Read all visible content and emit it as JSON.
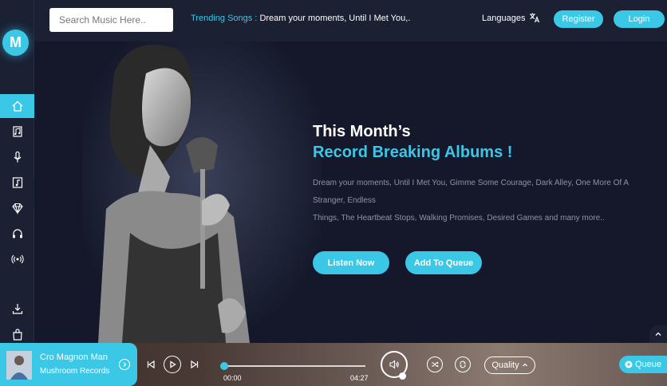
{
  "brand": {
    "logo_letter": "M",
    "accent": "#3bc8e7",
    "background": "#14182a"
  },
  "header": {
    "search": {
      "placeholder": "Search Music Here.."
    },
    "trending": {
      "label": "Trending Songs :",
      "songs": "Dream your moments, Until I Met You,."
    },
    "languages_label": "Languages",
    "register_label": "Register",
    "login_label": "Login"
  },
  "sidebar": {
    "items": [
      {
        "icon": "home-icon",
        "active": true
      },
      {
        "icon": "albums-icon",
        "active": false
      },
      {
        "icon": "microphone-icon",
        "active": false
      },
      {
        "icon": "music-note-icon",
        "active": false
      },
      {
        "icon": "diamond-icon",
        "active": false
      },
      {
        "icon": "headphones-icon",
        "active": false
      },
      {
        "icon": "radio-icon",
        "active": false
      },
      {
        "icon": "download-icon",
        "active": false
      },
      {
        "icon": "shopping-bag-icon",
        "active": false
      }
    ]
  },
  "hero": {
    "title_line1": "This Month’s",
    "title_line2": "Record Breaking Albums !",
    "desc_line1": "Dream your moments, Until I Met You, Gimme Some Courage, Dark Alley, One More Of A",
    "desc_line2": "Stranger, Endless",
    "desc_line3": "Things, The Heartbeat Stops, Walking Promises, Desired Games and many more..",
    "listen_label": "Listen Now",
    "queue_label": "Add To Queue"
  },
  "player": {
    "song_title": "Cro Magnon Man",
    "artist": "Mushroom Records",
    "current_time": "00:00",
    "total_time": "04:27",
    "progress": 0,
    "quality_label": "Quality",
    "queue_label": "Queue"
  }
}
